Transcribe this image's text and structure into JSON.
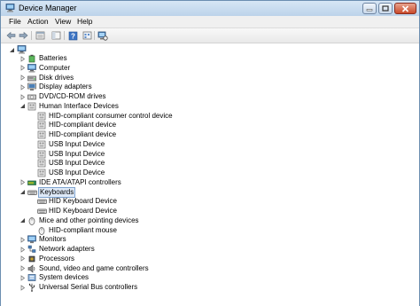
{
  "window": {
    "title": "Device Manager",
    "icon": "computer-icon",
    "controls": [
      "minimize",
      "maximize",
      "close"
    ]
  },
  "menu": [
    "File",
    "Action",
    "View",
    "Help"
  ],
  "toolbar": {
    "buttons": [
      "back-icon",
      "forward-icon",
      "properties-icon",
      "show-hide-console-tree-icon",
      "help-icon",
      "view-icon",
      "scan-hardware-icon"
    ]
  },
  "tree": {
    "root_icon": "computer-icon",
    "items": [
      {
        "label": "Batteries",
        "level": 1,
        "expander": "collapsed",
        "icon": "battery-icon"
      },
      {
        "label": "Computer",
        "level": 1,
        "expander": "collapsed",
        "icon": "computer-icon"
      },
      {
        "label": "Disk drives",
        "level": 1,
        "expander": "collapsed",
        "icon": "disk-drive-icon"
      },
      {
        "label": "Display adapters",
        "level": 1,
        "expander": "collapsed",
        "icon": "display-adapter-icon"
      },
      {
        "label": "DVD/CD-ROM drives",
        "level": 1,
        "expander": "collapsed",
        "icon": "dvd-drive-icon"
      },
      {
        "label": "Human Interface Devices",
        "level": 1,
        "expander": "expanded",
        "icon": "hid-icon"
      },
      {
        "label": "HID-compliant consumer control device",
        "level": 2,
        "expander": "none",
        "icon": "hid-icon"
      },
      {
        "label": "HID-compliant device",
        "level": 2,
        "expander": "none",
        "icon": "hid-icon"
      },
      {
        "label": "HID-compliant device",
        "level": 2,
        "expander": "none",
        "icon": "hid-icon"
      },
      {
        "label": "USB Input Device",
        "level": 2,
        "expander": "none",
        "icon": "hid-icon"
      },
      {
        "label": "USB Input Device",
        "level": 2,
        "expander": "none",
        "icon": "hid-icon"
      },
      {
        "label": "USB Input Device",
        "level": 2,
        "expander": "none",
        "icon": "hid-icon"
      },
      {
        "label": "USB Input Device",
        "level": 2,
        "expander": "none",
        "icon": "hid-icon"
      },
      {
        "label": "IDE ATA/ATAPI controllers",
        "level": 1,
        "expander": "collapsed",
        "icon": "ide-controller-icon"
      },
      {
        "label": "Keyboards",
        "level": 1,
        "expander": "expanded",
        "icon": "keyboard-icon",
        "selected": true
      },
      {
        "label": "HID Keyboard Device",
        "level": 2,
        "expander": "none",
        "icon": "keyboard-icon"
      },
      {
        "label": "HID Keyboard Device",
        "level": 2,
        "expander": "none",
        "icon": "keyboard-icon"
      },
      {
        "label": "Mice and other pointing devices",
        "level": 1,
        "expander": "expanded",
        "icon": "mouse-icon"
      },
      {
        "label": "HID-compliant mouse",
        "level": 2,
        "expander": "none",
        "icon": "mouse-icon"
      },
      {
        "label": "Monitors",
        "level": 1,
        "expander": "collapsed",
        "icon": "monitor-icon"
      },
      {
        "label": "Network adapters",
        "level": 1,
        "expander": "collapsed",
        "icon": "network-adapter-icon"
      },
      {
        "label": "Processors",
        "level": 1,
        "expander": "collapsed",
        "icon": "processor-icon"
      },
      {
        "label": "Sound, video and game controllers",
        "level": 1,
        "expander": "collapsed",
        "icon": "sound-icon"
      },
      {
        "label": "System devices",
        "level": 1,
        "expander": "collapsed",
        "icon": "system-device-icon"
      },
      {
        "label": "Universal Serial Bus controllers",
        "level": 1,
        "expander": "collapsed",
        "icon": "usb-icon"
      }
    ]
  }
}
